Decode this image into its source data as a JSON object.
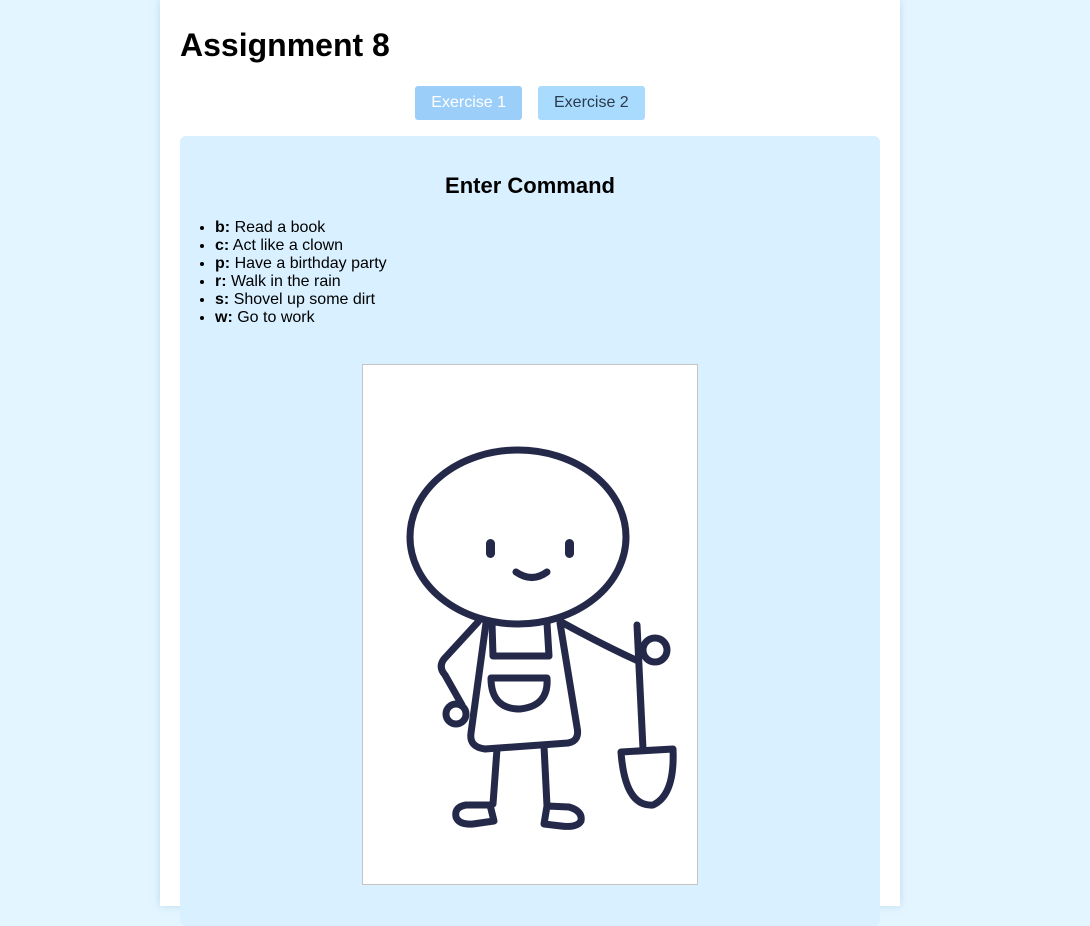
{
  "page": {
    "title": "Assignment 8"
  },
  "tabs": [
    {
      "label": "Exercise 1",
      "active": true
    },
    {
      "label": "Exercise 2",
      "active": false
    }
  ],
  "panel": {
    "heading": "Enter Command",
    "commands": [
      {
        "key": "b:",
        "text": "Read a book"
      },
      {
        "key": "c:",
        "text": "Act like a clown"
      },
      {
        "key": "p:",
        "text": "Have a birthday party"
      },
      {
        "key": "r:",
        "text": "Walk in the rain"
      },
      {
        "key": "s:",
        "text": "Shovel up some dirt"
      },
      {
        "key": "w:",
        "text": "Go to work"
      }
    ]
  },
  "canvas": {
    "figure": "stick-figure-with-shovel-icon",
    "stroke_color": "#242849"
  },
  "colors": {
    "background": "#e3f5ff",
    "panel": "#d8f0ff",
    "tab_active": "#9bcff9",
    "tab_inactive": "#a9dbff"
  }
}
